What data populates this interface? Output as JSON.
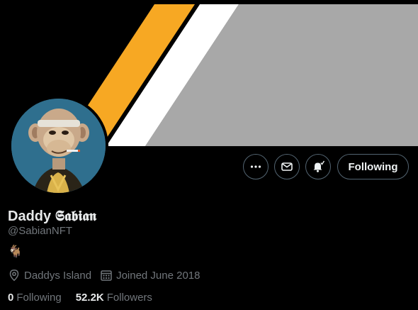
{
  "profile": {
    "display_name_plain": "Daddy",
    "display_name_styled": "𝕾𝖆𝖇𝖎𝖆𝖓",
    "handle": "@SabianNFT",
    "bio": "🐐",
    "location": "Daddys Island",
    "joined": "Joined June 2018"
  },
  "stats": {
    "following_count": "0",
    "following_label": "Following",
    "followers_count": "52.2K",
    "followers_label": "Followers"
  },
  "actions": {
    "follow_label": "Following",
    "more_icon": "more-icon",
    "message_icon": "message-icon",
    "notify_icon": "bell-icon"
  },
  "colors": {
    "background": "#000000",
    "banner_orange": "#f7a823",
    "banner_white": "#ffffff",
    "banner_gray": "#a8a8a8",
    "avatar_bg": "#2f6f8e",
    "secondary_text": "#71767b",
    "button_border": "#536471"
  }
}
